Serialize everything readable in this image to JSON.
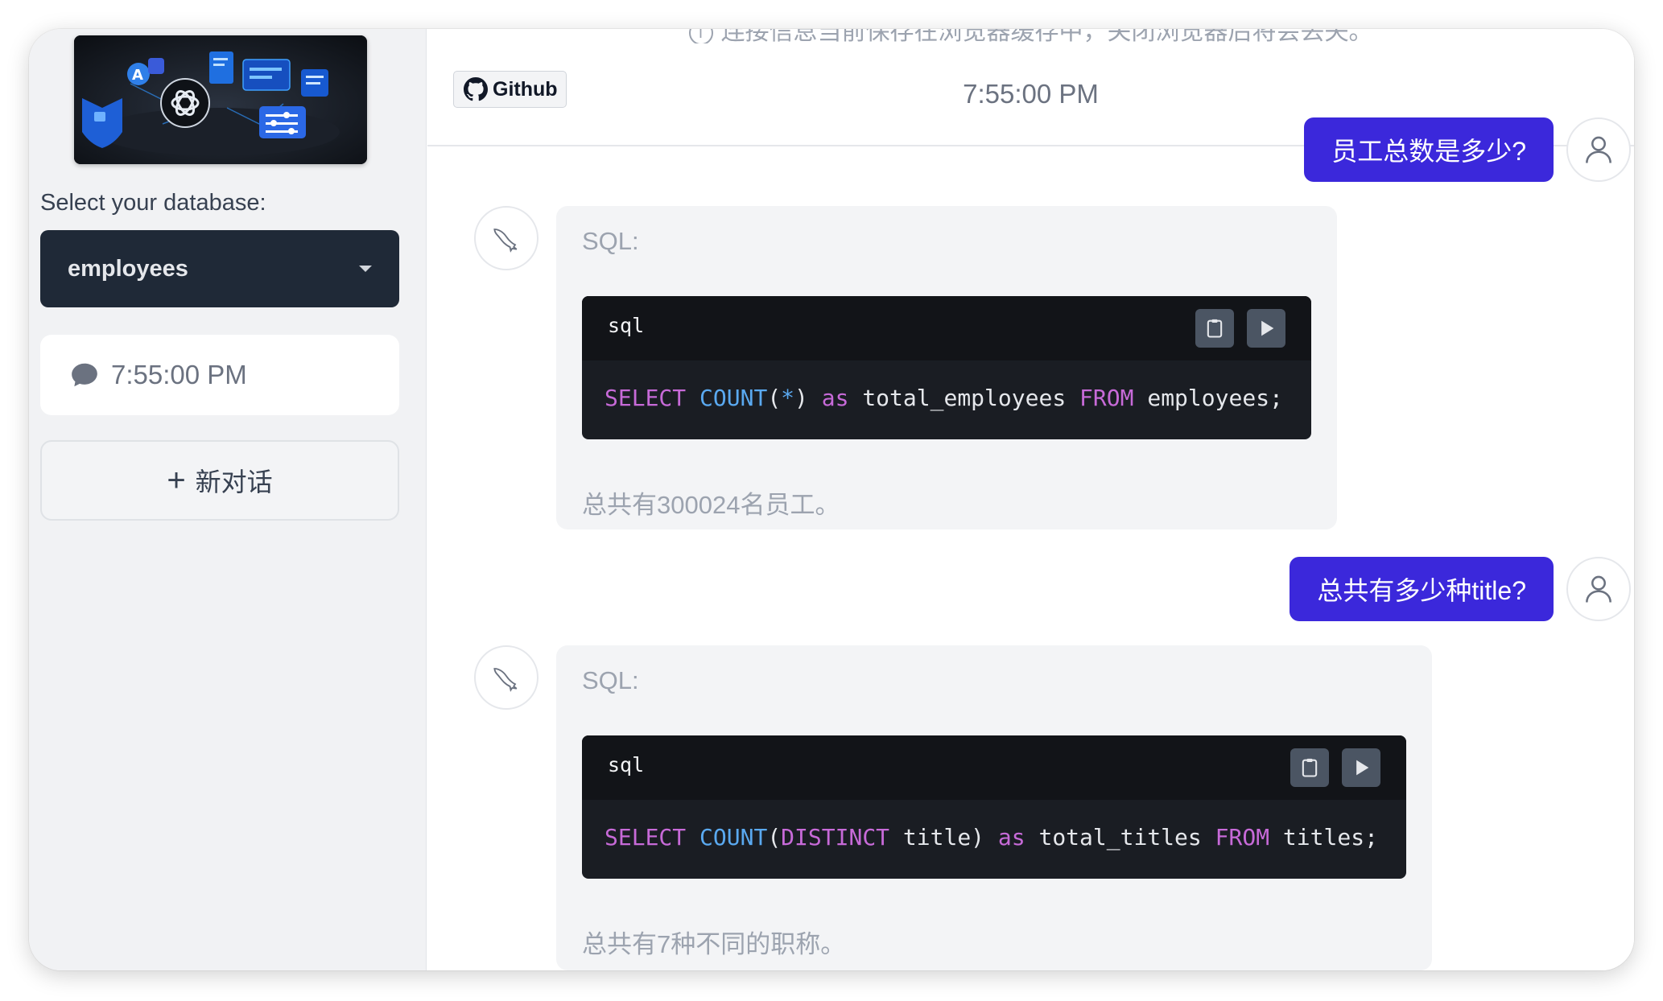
{
  "sidebar": {
    "banner_alt": "OpenAI data illustration",
    "db_label": "Select your database:",
    "db_selected": "employees",
    "history": [
      {
        "label": "7:55:00 PM"
      }
    ],
    "new_chat_label": "新对话"
  },
  "notice": "连接信息当前保存在浏览器缓存中，关闭浏览器后将会丢失。",
  "topbar": {
    "github_label": "Github",
    "time": "7:55:00 PM"
  },
  "messages": [
    {
      "role": "user",
      "text": "员工总数是多少?"
    },
    {
      "role": "bot",
      "sql_label": "SQL:",
      "code_lang": "sql",
      "code_tokens": [
        {
          "t": "SELECT",
          "c": "kw"
        },
        {
          "t": " "
        },
        {
          "t": "COUNT",
          "c": "fn"
        },
        {
          "t": "("
        },
        {
          "t": "*",
          "c": "fn"
        },
        {
          "t": ") "
        },
        {
          "t": "as",
          "c": "kw"
        },
        {
          "t": " total_employees "
        },
        {
          "t": "FROM",
          "c": "kw"
        },
        {
          "t": " employees;"
        }
      ],
      "answer": "总共有300024名员工。"
    },
    {
      "role": "user",
      "text": "总共有多少种title?"
    },
    {
      "role": "bot",
      "sql_label": "SQL:",
      "code_lang": "sql",
      "code_tokens": [
        {
          "t": "SELECT",
          "c": "kw"
        },
        {
          "t": " "
        },
        {
          "t": "COUNT",
          "c": "fn"
        },
        {
          "t": "("
        },
        {
          "t": "DISTINCT",
          "c": "kw"
        },
        {
          "t": " title) "
        },
        {
          "t": "as",
          "c": "kw"
        },
        {
          "t": " total_titles "
        },
        {
          "t": "FROM",
          "c": "kw"
        },
        {
          "t": " titles;"
        }
      ],
      "answer": "总共有7种不同的职称。"
    }
  ],
  "colors": {
    "user_bubble": "#3b28db",
    "sidebar_bg": "#f1f2f4",
    "select_bg": "#1f2937",
    "code_bg": "#1a1d23",
    "sql_keyword": "#c76ad8",
    "sql_function": "#5aa9f0"
  },
  "icons": {
    "chat": "chat-bubble-icon",
    "plus": "plus-icon",
    "github": "github-icon",
    "user_avatar": "user-icon",
    "bot_avatar": "mysql-dolphin-icon",
    "copy": "clipboard-icon",
    "run": "play-icon"
  }
}
